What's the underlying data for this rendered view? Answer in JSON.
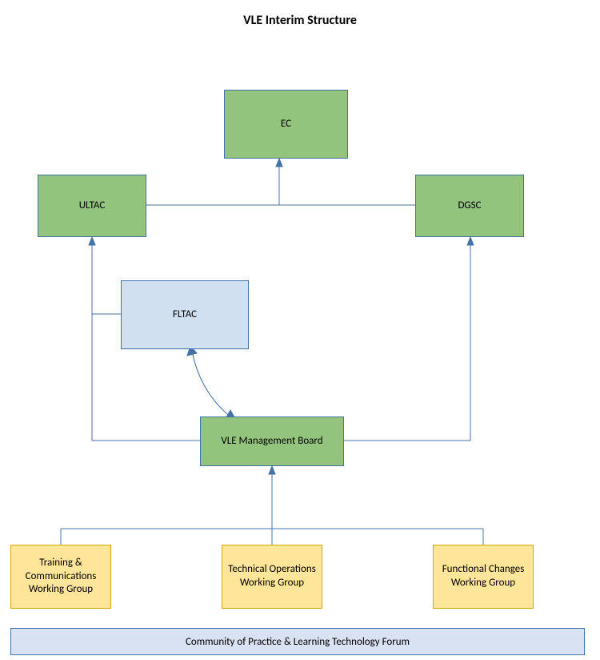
{
  "title": "VLE  Interim Structure",
  "nodes": {
    "ec": "EC",
    "ultac": "ULTAC",
    "dgsc": "DGSC",
    "fltac": "FLTAC",
    "vle_mgmt": "VLE Management Board",
    "wg_training": "Training & Communications Working Group",
    "wg_tech": "Technical Operations Working Group",
    "wg_func": "Functional Changes Working Group",
    "footer": "Community of Practice & Learning Technology Forum"
  },
  "colors": {
    "green": "#93c47d",
    "blue_light": "#d0e0f0",
    "yellow": "#ffe599",
    "footer_blue": "#d9e2f3",
    "line": "#4472a8"
  }
}
